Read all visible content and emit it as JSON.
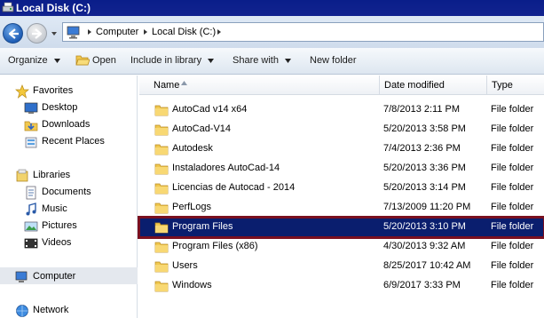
{
  "window": {
    "title": "Local Disk (C:)"
  },
  "address": {
    "crumbs": [
      "Computer",
      "Local Disk (C:)"
    ]
  },
  "toolbar": {
    "organize": "Organize",
    "open": "Open",
    "include_in_library": "Include in library",
    "share_with": "Share with",
    "new_folder": "New folder"
  },
  "navpane": {
    "favorites": "Favorites",
    "desktop": "Desktop",
    "downloads": "Downloads",
    "recent_places": "Recent Places",
    "libraries": "Libraries",
    "documents": "Documents",
    "music": "Music",
    "pictures": "Pictures",
    "videos": "Videos",
    "computer": "Computer",
    "network": "Network"
  },
  "columns": {
    "name": "Name",
    "date_modified": "Date modified",
    "type": "Type"
  },
  "files": [
    {
      "name": "AutoCad v14 x64",
      "date": "7/8/2013 2:11 PM",
      "type": "File folder"
    },
    {
      "name": "AutoCad-V14",
      "date": "5/20/2013 3:58 PM",
      "type": "File folder"
    },
    {
      "name": "Autodesk",
      "date": "7/4/2013 2:36 PM",
      "type": "File folder"
    },
    {
      "name": "Instaladores AutoCad-14",
      "date": "5/20/2013 3:36 PM",
      "type": "File folder"
    },
    {
      "name": "Licencias de Autocad - 2014",
      "date": "5/20/2013 3:14 PM",
      "type": "File folder"
    },
    {
      "name": "PerfLogs",
      "date": "7/13/2009 11:20 PM",
      "type": "File folder"
    },
    {
      "name": "Program Files",
      "date": "5/20/2013 3:10 PM",
      "type": "File folder"
    },
    {
      "name": "Program Files (x86)",
      "date": "4/30/2013 9:32 AM",
      "type": "File folder"
    },
    {
      "name": "Users",
      "date": "8/25/2017 10:42 AM",
      "type": "File folder"
    },
    {
      "name": "Windows",
      "date": "6/9/2017 3:33 PM",
      "type": "File folder"
    }
  ]
}
